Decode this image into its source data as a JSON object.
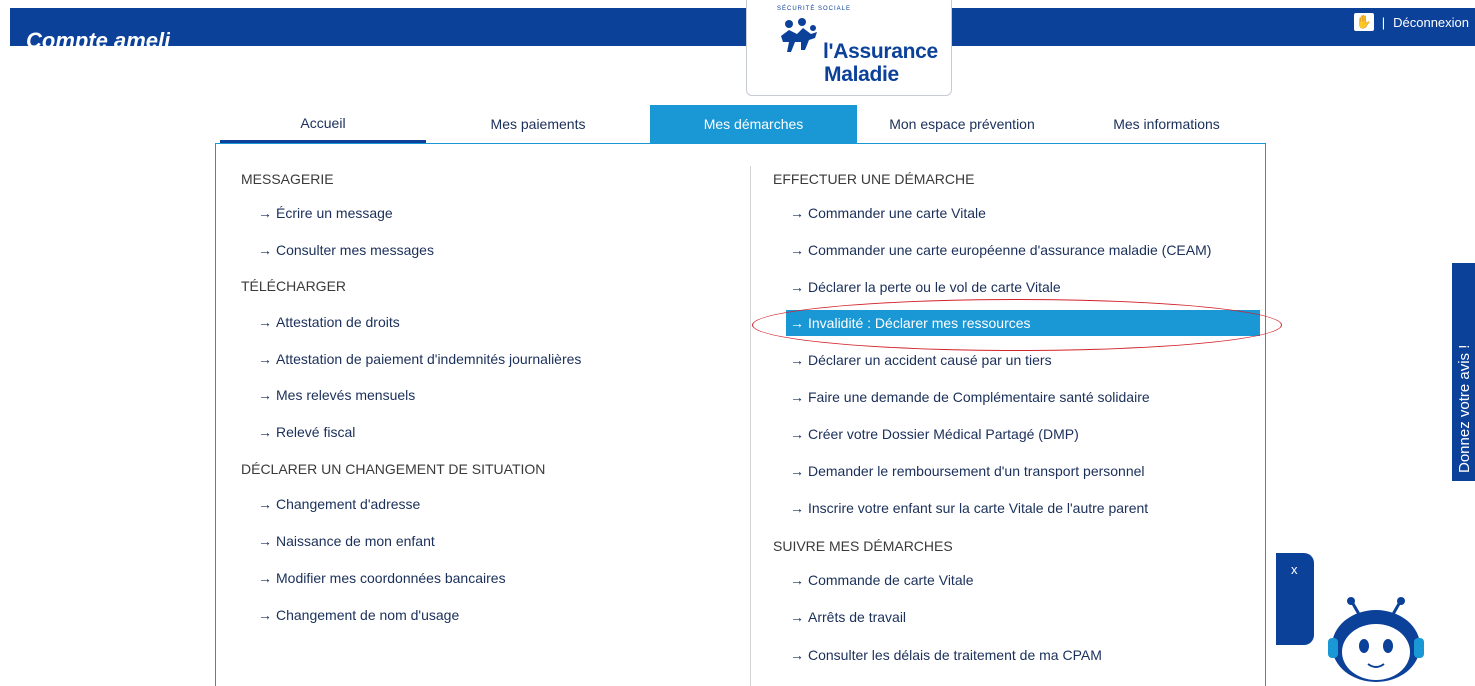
{
  "header": {
    "app_title": "Compte ameli",
    "logout": "Déconnexion",
    "separator": "|",
    "logo_line1": "l'Assurance",
    "logo_line2": "Maladie",
    "logo_small": "SÉCURITÉ SOCIALE"
  },
  "tabs": [
    {
      "label": "Accueil"
    },
    {
      "label": "Mes paiements"
    },
    {
      "label": "Mes démarches",
      "active": true
    },
    {
      "label": "Mon espace prévention"
    },
    {
      "label": "Mes informations"
    }
  ],
  "left": {
    "sections": [
      {
        "title": "MESSAGERIE",
        "items": [
          "Écrire un message",
          "Consulter mes messages"
        ]
      },
      {
        "title": "TÉLÉCHARGER",
        "items": [
          "Attestation de droits",
          "Attestation de paiement d'indemnités journalières",
          "Mes relevés mensuels",
          "Relevé fiscal"
        ]
      },
      {
        "title": "DÉCLARER UN CHANGEMENT DE SITUATION",
        "items": [
          "Changement d'adresse",
          "Naissance de mon enfant",
          "Modifier mes coordonnées bancaires",
          "Changement de nom d'usage"
        ]
      }
    ]
  },
  "right": {
    "sections": [
      {
        "title": "EFFECTUER UNE DÉMARCHE",
        "items": [
          "Commander une carte Vitale",
          "Commander une carte européenne d'assurance maladie (CEAM)",
          "Déclarer la perte ou le vol de carte Vitale",
          "Invalidité : Déclarer mes ressources",
          "Déclarer un accident causé par un tiers",
          "Faire une demande de Complémentaire santé solidaire",
          "Créer votre Dossier Médical Partagé (DMP)",
          "Demander le remboursement d'un transport personnel",
          "Inscrire votre enfant sur la carte Vitale de l'autre parent"
        ]
      },
      {
        "title": "SUIVRE MES DÉMARCHES",
        "items": [
          "Commande de carte Vitale",
          "Arrêts de travail",
          "Consulter les délais de traitement de ma CPAM"
        ]
      }
    ]
  },
  "arrow_glyph": "→",
  "feedback_label": "Donnez votre avis !",
  "chat_close": "x",
  "icons": {
    "accessibility": "sign-language-icon",
    "link": "arrow-right-icon",
    "chatbot": "robot-avatar-icon"
  },
  "colors": {
    "navy": "#0c419a",
    "accent": "#1a97d5",
    "annotation": "#d2232a"
  }
}
